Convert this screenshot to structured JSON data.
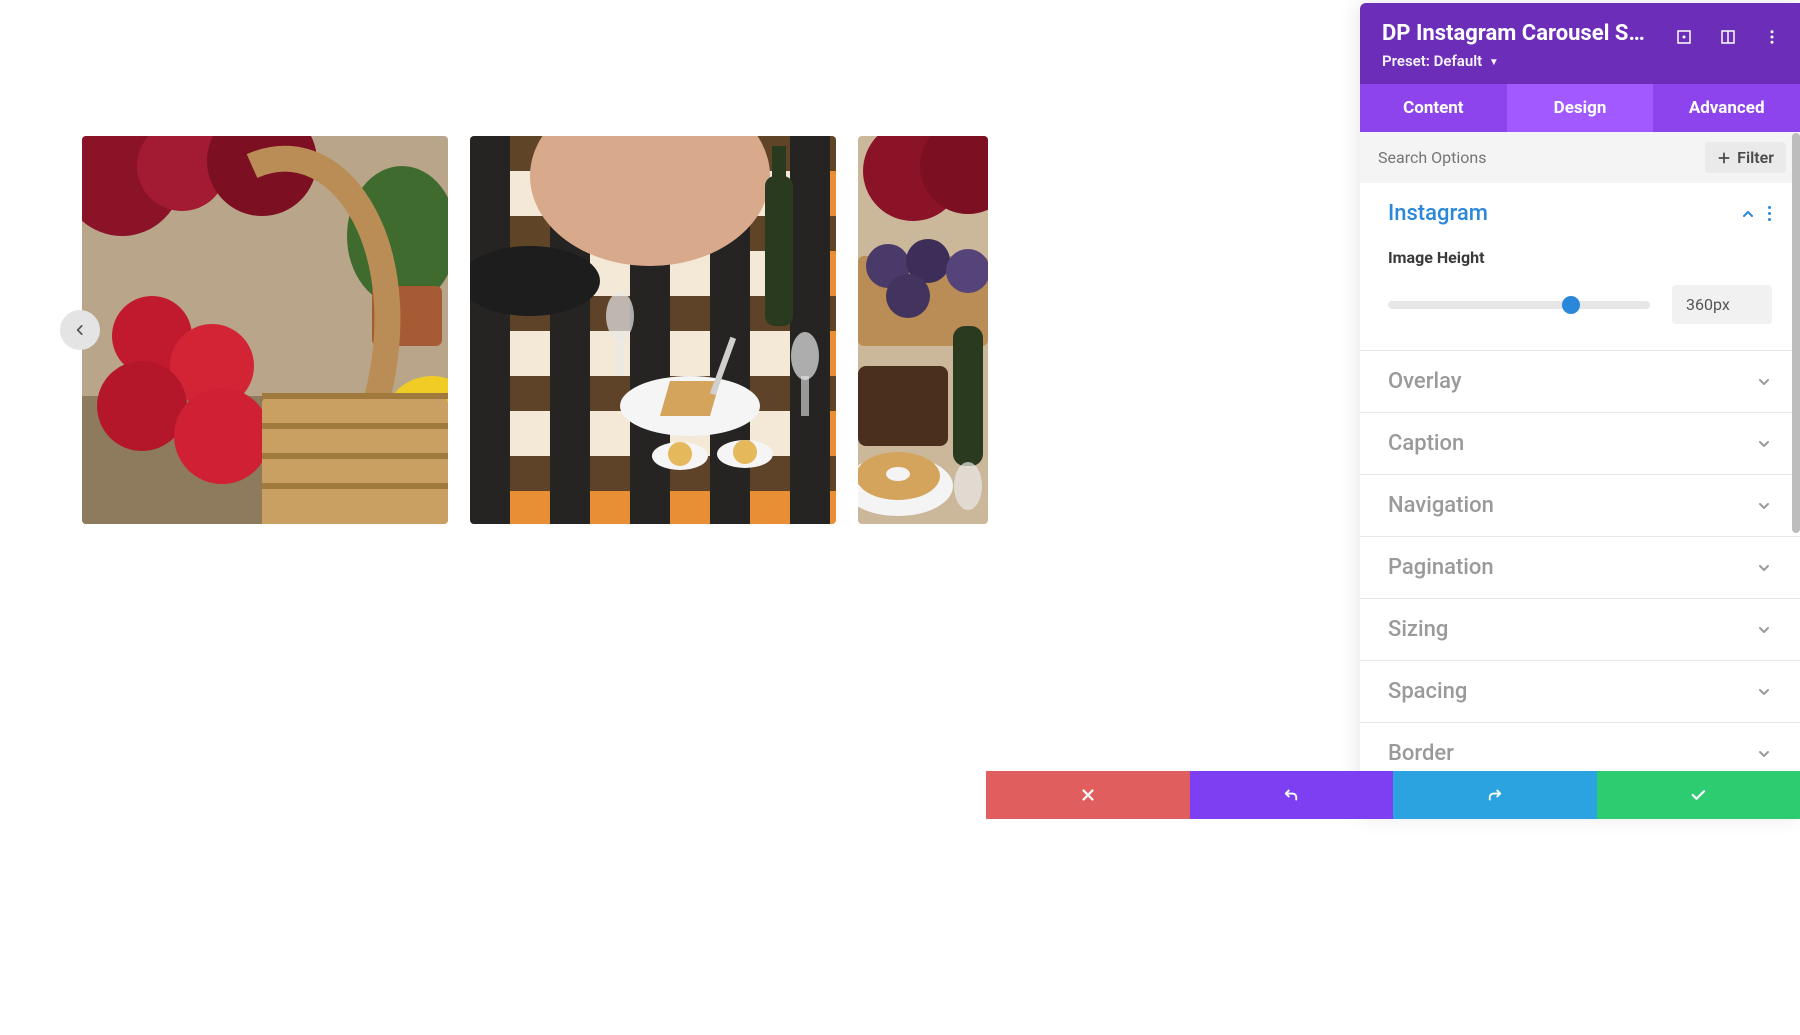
{
  "panel": {
    "title": "DP Instagram Carousel Setti...",
    "preset_prefix": "Preset:",
    "preset_value": "Default"
  },
  "tabs": [
    {
      "label": "Content"
    },
    {
      "label": "Design"
    },
    {
      "label": "Advanced"
    }
  ],
  "search": {
    "placeholder": "Search Options"
  },
  "filter_label": "Filter",
  "sections": [
    {
      "title": "Instagram",
      "expanded": true,
      "field": {
        "label": "Image Height",
        "value": "360px",
        "percent": 70
      }
    },
    {
      "title": "Overlay"
    },
    {
      "title": "Caption"
    },
    {
      "title": "Navigation"
    },
    {
      "title": "Pagination"
    },
    {
      "title": "Sizing"
    },
    {
      "title": "Spacing"
    },
    {
      "title": "Border"
    }
  ]
}
